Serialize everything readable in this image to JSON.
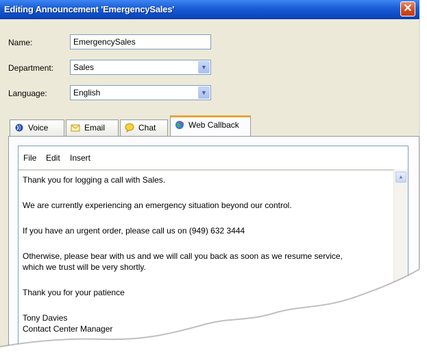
{
  "window": {
    "title": "Editing Announcement 'EmergencySales'",
    "close_glyph": "✕"
  },
  "form": {
    "name_label": "Name:",
    "name_value": "EmergencySales",
    "department_label": "Department:",
    "department_value": "Sales",
    "language_label": "Language:",
    "language_value": "English"
  },
  "tabs": [
    {
      "label": "Voice",
      "icon": "voice-icon"
    },
    {
      "label": "Email",
      "icon": "email-icon"
    },
    {
      "label": "Chat",
      "icon": "chat-icon"
    },
    {
      "label": "Web Callback",
      "icon": "web-callback-icon",
      "active": true
    }
  ],
  "editor": {
    "menu": [
      "File",
      "Edit",
      "Insert"
    ],
    "lines": [
      "Thank you for logging a call with Sales.",
      "We are currently experiencing an emergency situation beyond our control.",
      "If you have an urgent order, please call us on (949) 632 3444",
      "Otherwise, please bear with us and we will call you back as soon as we resume service,",
      "which we trust will be very shortly.",
      "Thank you for your patience",
      "Tony Davies",
      "Contact Center Manager"
    ]
  },
  "colors": {
    "titlebar": "#0c4bc4",
    "active_tab_accent": "#e6a637",
    "window_bg": "#ece9d8"
  }
}
